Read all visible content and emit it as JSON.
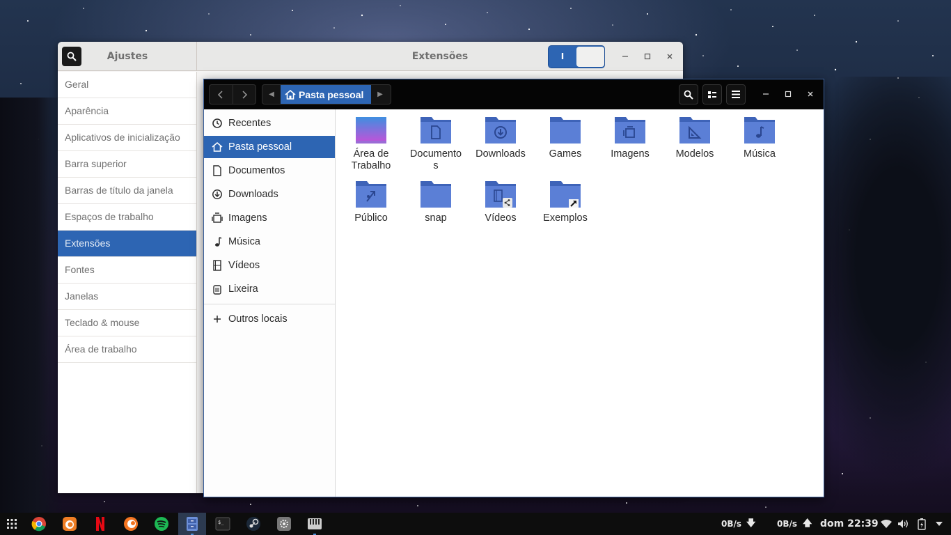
{
  "tweaks": {
    "title": "Ajustes",
    "main_title": "Extensões",
    "switch_on_label": "I",
    "sidebar_items": [
      {
        "label": "Geral"
      },
      {
        "label": "Aparência"
      },
      {
        "label": "Aplicativos de inicialização"
      },
      {
        "label": "Barra superior"
      },
      {
        "label": "Barras de título da janela"
      },
      {
        "label": "Espaços de trabalho"
      },
      {
        "label": "Extensões"
      },
      {
        "label": "Fontes"
      },
      {
        "label": "Janelas"
      },
      {
        "label": "Teclado & mouse"
      },
      {
        "label": "Área de trabalho"
      }
    ],
    "active_item": "Extensões"
  },
  "files": {
    "path_current": "Pasta pessoal",
    "sidebar": {
      "recentes": "Recentes",
      "pasta_pessoal": "Pasta pessoal",
      "documentos": "Documentos",
      "downloads": "Downloads",
      "imagens": "Imagens",
      "musica": "Música",
      "videos": "Vídeos",
      "lixeira": "Lixeira",
      "outros_locais": "Outros locais"
    },
    "folders": {
      "area_de_trabalho": "Área de Trabalho",
      "documentos_l1": "Documento",
      "documentos_l2": "s",
      "downloads": "Downloads",
      "games": "Games",
      "imagens": "Imagens",
      "modelos": "Modelos",
      "musica": "Música",
      "publico": "Público",
      "snap": "snap",
      "videos": "Vídeos",
      "exemplos": "Exemplos"
    }
  },
  "taskbar": {
    "net_down": "0B/s",
    "net_up": "0B/s",
    "clock": "dom 22:39"
  },
  "colors": {
    "accent": "#2d65b3",
    "folder": "#5b7fd6"
  }
}
